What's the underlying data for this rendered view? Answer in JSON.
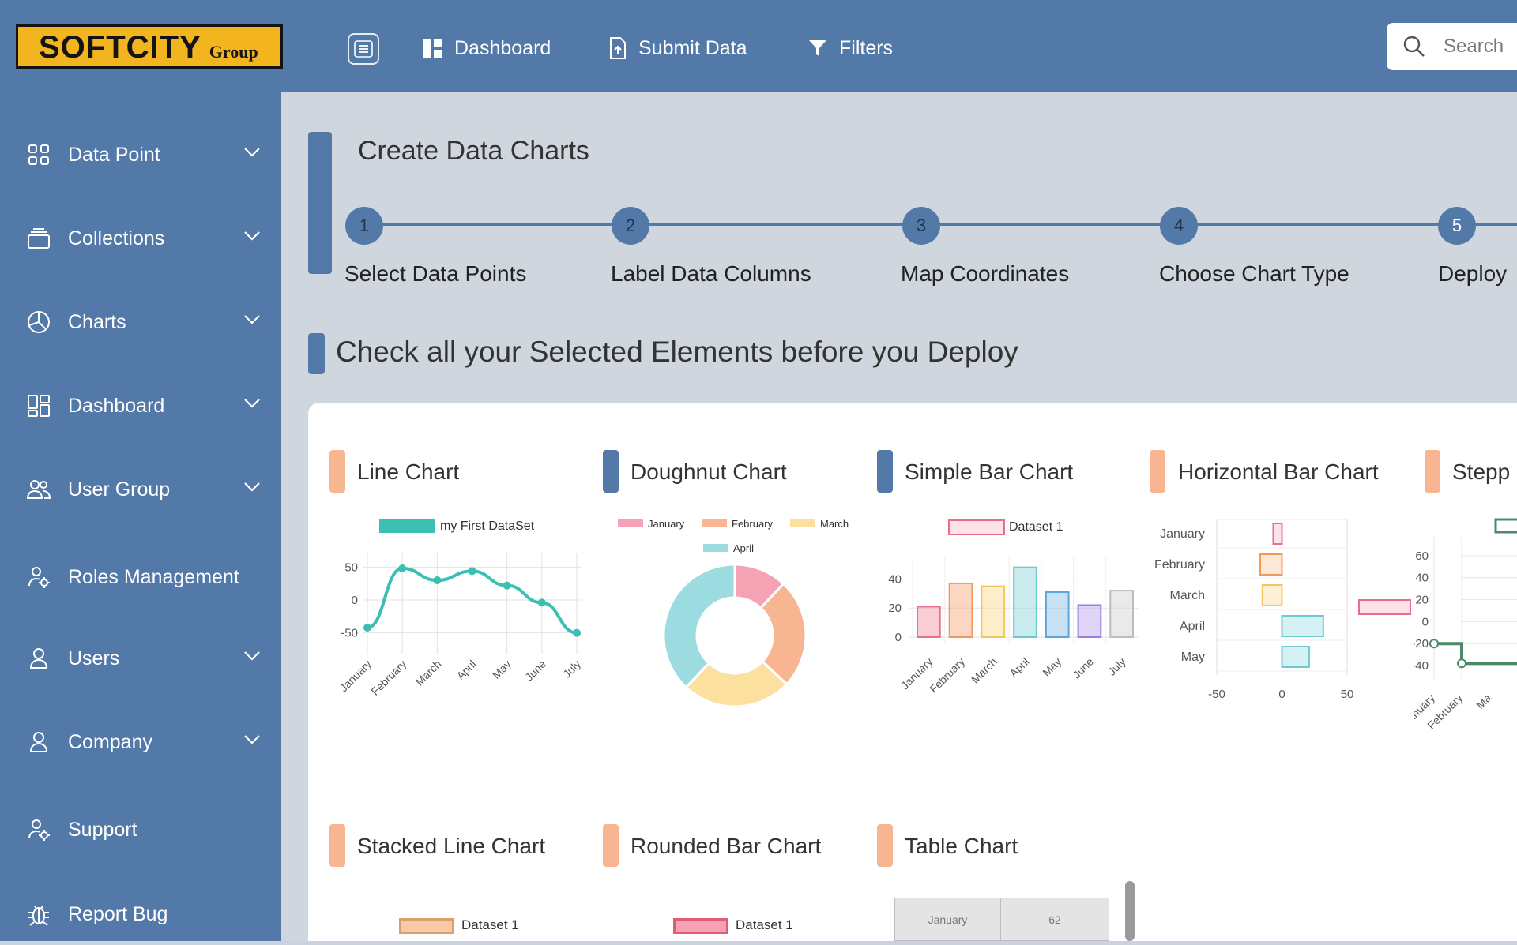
{
  "brand": {
    "logo_main": "SOFTCITY",
    "logo_sub": "Group"
  },
  "topnav": {
    "dashboard": "Dashboard",
    "submit_data": "Submit Data",
    "filters": "Filters",
    "search_placeholder": "Search"
  },
  "sidebar": {
    "items": [
      {
        "label": "Data Point",
        "icon": "grid-icon",
        "expandable": true
      },
      {
        "label": "Collections",
        "icon": "layers-icon",
        "expandable": true
      },
      {
        "label": "Charts",
        "icon": "pie-chart-icon",
        "expandable": true
      },
      {
        "label": "Dashboard",
        "icon": "dashboard-icon",
        "expandable": true
      },
      {
        "label": "User Group",
        "icon": "users-icon",
        "expandable": true
      },
      {
        "label": "Roles Management",
        "icon": "user-gear-icon",
        "expandable": false
      },
      {
        "label": "Users",
        "icon": "user-icon",
        "expandable": true
      },
      {
        "label": "Company",
        "icon": "user-icon",
        "expandable": true
      },
      {
        "label": "Support",
        "icon": "user-gear-icon",
        "expandable": false
      },
      {
        "label": "Report Bug",
        "icon": "bug-icon",
        "expandable": false
      }
    ]
  },
  "wizard": {
    "title": "Create Data Charts",
    "steps": [
      {
        "num": "1",
        "label": "Select Data Points"
      },
      {
        "num": "2",
        "label": "Label Data Columns"
      },
      {
        "num": "3",
        "label": "Map Coordinates"
      },
      {
        "num": "4",
        "label": "Choose Chart Type"
      },
      {
        "num": "5",
        "label": "Deploy"
      }
    ],
    "active_step": 5
  },
  "check_title": "Check all your Selected Elements before you Deploy",
  "charts": {
    "titles": {
      "line": "Line Chart",
      "doughnut": "Doughnut Chart",
      "simple_bar": "Simple Bar Chart",
      "horizontal_bar": "Horizontal Bar Chart",
      "stepped": "Stepp",
      "stacked_line": "Stacked Line Chart",
      "rounded_bar": "Rounded Bar Chart",
      "table": "Table Chart"
    },
    "colors": {
      "teal": "#3bbfb3",
      "pink": "#f5a3b4",
      "orange": "#f8b592",
      "yellow": "#fce0a0",
      "cyan": "#9cdbe0",
      "purple": "#c7b3f2",
      "grey": "#d8d8d8",
      "green": "#4a8a6a"
    }
  },
  "chart_data": [
    {
      "type": "line",
      "title": "Line Chart",
      "categories": [
        "January",
        "February",
        "March",
        "April",
        "May",
        "June",
        "July"
      ],
      "series": [
        {
          "name": "my First DataSet",
          "values": [
            -42,
            48,
            30,
            44,
            22,
            -4,
            -50
          ]
        }
      ],
      "y_ticks": [
        "50",
        "0",
        "-50"
      ],
      "ylim": [
        -60,
        60
      ]
    },
    {
      "type": "pie",
      "title": "Doughnut Chart",
      "categories": [
        "January",
        "February",
        "March",
        "April"
      ],
      "values": [
        12,
        25,
        25,
        38
      ]
    },
    {
      "type": "bar",
      "title": "Simple Bar Chart",
      "categories": [
        "January",
        "February",
        "March",
        "April",
        "May",
        "June",
        "July"
      ],
      "series": [
        {
          "name": "Dataset 1",
          "values": [
            21,
            37,
            35,
            48,
            31,
            22,
            32
          ]
        }
      ],
      "y_ticks": [
        "40",
        "20",
        "0"
      ],
      "ylim": [
        0,
        50
      ]
    },
    {
      "type": "bar",
      "title": "Horizontal Bar Chart",
      "categories": [
        "January",
        "February",
        "March",
        "April",
        "May"
      ],
      "values": [
        -8,
        -20,
        -18,
        38,
        25
      ],
      "x_ticks": [
        "-50",
        "0",
        "50"
      ],
      "xlim": [
        -60,
        60
      ]
    },
    {
      "type": "line",
      "title": "Stepp",
      "categories": [
        "January",
        "February",
        "Ma"
      ],
      "values": [
        -20,
        -38
      ],
      "y_ticks": [
        "60",
        "40",
        "20",
        "0",
        "-20",
        "-40"
      ],
      "ylim": [
        -45,
        70
      ]
    }
  ],
  "table_preview": {
    "cells": [
      "January",
      "62"
    ]
  },
  "lower_legends": {
    "stacked": "Dataset 1",
    "rounded": "Dataset 1"
  }
}
